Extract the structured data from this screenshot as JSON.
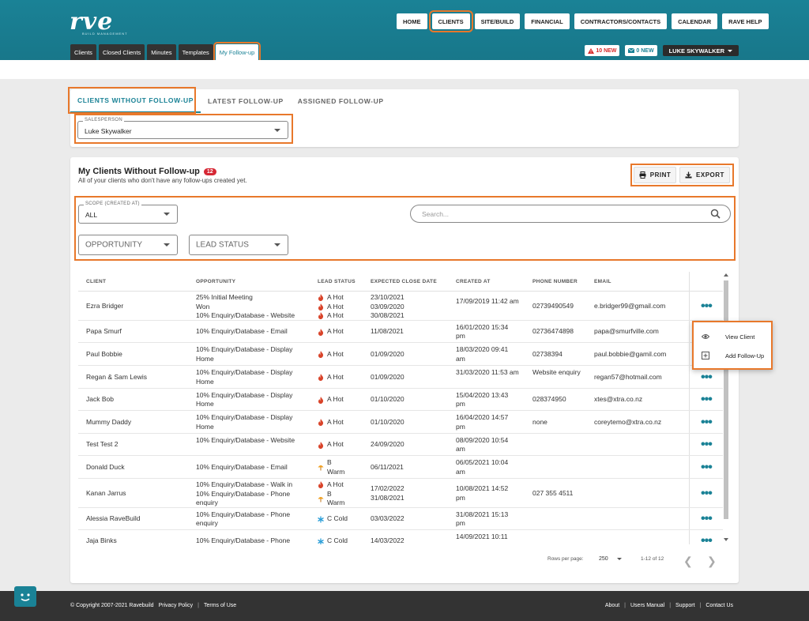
{
  "app": {
    "logo_text": "rve",
    "logo_sub": "BUILD MANAGEMENT"
  },
  "topnav": [
    "HOME",
    "CLIENTS",
    "SITE/BUILD",
    "FINANCIAL",
    "CONTRACTORS/CONTACTS",
    "CALENDAR",
    "RAVE HELP"
  ],
  "subtabs": [
    "Clients",
    "Closed Clients",
    "Minutes",
    "Templates",
    "My Follow-up"
  ],
  "alerts": {
    "red": "10 NEW",
    "blue": "0 NEW",
    "user": "LUKE SKYWALKER"
  },
  "tabs": [
    "CLIENTS WITHOUT FOLLOW-UP",
    "LATEST FOLLOW-UP",
    "ASSIGNED FOLLOW-UP"
  ],
  "salesperson": {
    "legend": "SALESPERSON",
    "value": "Luke Skywalker"
  },
  "section": {
    "title": "My Clients Without Follow-up",
    "badge": "12",
    "subtitle": "All of your clients who don't have any follow-ups created yet.",
    "print": "PRINT",
    "export": "EXPORT"
  },
  "filters": {
    "scope_legend": "SCOPE (CREATED AT)",
    "scope_value": "ALL",
    "search_placeholder": "Search...",
    "opportunity": "OPPORTUNITY",
    "lead_status": "LEAD STATUS"
  },
  "table": {
    "headers": [
      "CLIENT",
      "OPPORTUNITY",
      "LEAD STATUS",
      "EXPECTED CLOSE DATE",
      "CREATED AT",
      "PHONE NUMBER",
      "EMAIL"
    ],
    "rows": [
      {
        "client": "Ezra Bridger",
        "opportunity": [
          "25% Initial Meeting",
          "Won",
          "10% Enquiry/Database - Website"
        ],
        "lead": [
          [
            "fire",
            "A Hot"
          ],
          [
            "fire",
            "A Hot"
          ],
          [
            "fire",
            "A Hot"
          ]
        ],
        "close": [
          "23/10/2021",
          "03/09/2020",
          "30/08/2021"
        ],
        "created": "17/09/2019 11:42 am",
        "phone": "02739490549",
        "email": "e.bridger99@gmail.com"
      },
      {
        "client": "Papa Smurf",
        "opportunity": [
          "10% Enquiry/Database - Email"
        ],
        "lead": [
          [
            "fire",
            "A Hot"
          ]
        ],
        "close": [
          "11/08/2021"
        ],
        "created": "16/01/2020 15:34 pm",
        "phone": "02736474898",
        "email": "papa@smurfville.com"
      },
      {
        "client": "Paul Bobbie",
        "opportunity": [
          "10% Enquiry/Database - Display Home"
        ],
        "lead": [
          [
            "fire",
            "A Hot"
          ]
        ],
        "close": [
          "01/09/2020"
        ],
        "created": "18/03/2020 09:41 am",
        "phone": "02738394",
        "email": "paul.bobbie@gamil.com"
      },
      {
        "client": "Regan & Sam Lewis",
        "opportunity": [
          "10% Enquiry/Database - Display Home"
        ],
        "lead": [
          [
            "fire",
            "A Hot"
          ]
        ],
        "close": [
          "01/09/2020"
        ],
        "created": "31/03/2020 11:53 am",
        "phone": "Website enquiry",
        "email": "regan57@hotmail.com"
      },
      {
        "client": "Jack Bob",
        "opportunity": [
          "10% Enquiry/Database - Display Home"
        ],
        "lead": [
          [
            "fire",
            "A Hot"
          ]
        ],
        "close": [
          "01/10/2020"
        ],
        "created": "15/04/2020 13:43 pm",
        "phone": "028374950",
        "email": "xtes@xtra.co.nz"
      },
      {
        "client": "Mummy Daddy",
        "opportunity": [
          "10% Enquiry/Database - Display Home"
        ],
        "lead": [
          [
            "fire",
            "A Hot"
          ]
        ],
        "close": [
          "01/10/2020"
        ],
        "created": "16/04/2020 14:57 pm",
        "phone": "none",
        "email": "coreytemo@xtra.co.nz"
      },
      {
        "client": "Test Test 2",
        "opportunity": [
          "10% Enquiry/Database - Website"
        ],
        "lead": [
          [
            "fire",
            "A Hot"
          ]
        ],
        "close": [
          "24/09/2020"
        ],
        "created": "08/09/2020 10:54 am",
        "phone": "",
        "email": ""
      },
      {
        "client": "Donald Duck",
        "opportunity": [
          "10% Enquiry/Database - Email"
        ],
        "lead": [
          [
            "warm",
            "B Warm"
          ]
        ],
        "close": [
          "06/11/2021"
        ],
        "created": "06/05/2021 10:04 am",
        "phone": "",
        "email": ""
      },
      {
        "client": "Kanan Jarrus",
        "opportunity": [
          "10% Enquiry/Database - Walk in",
          "10% Enquiry/Database - Phone enquiry"
        ],
        "lead": [
          [
            "fire",
            "A Hot"
          ],
          [
            "warm",
            "B Warm"
          ]
        ],
        "close": [
          "17/02/2022",
          "31/08/2021"
        ],
        "created": "10/08/2021 14:52 pm",
        "phone": "027 355 4511",
        "email": ""
      },
      {
        "client": "Alessia RaveBuild",
        "opportunity": [
          "10% Enquiry/Database - Phone enquiry"
        ],
        "lead": [
          [
            "cold",
            "C Cold"
          ]
        ],
        "close": [
          "03/03/2022"
        ],
        "created": "31/08/2021 15:13 pm",
        "phone": "",
        "email": ""
      },
      {
        "client": "Jaja Binks",
        "opportunity": [
          "10% Enquiry/Database - Phone"
        ],
        "lead": [
          [
            "cold",
            "C Cold"
          ]
        ],
        "close": [
          "14/03/2022"
        ],
        "created": "14/09/2021 10:11",
        "phone": "",
        "email": ""
      }
    ]
  },
  "pagination": {
    "rows_label": "Rows per page:",
    "rows_value": "250",
    "range": "1-12 of 12"
  },
  "context_menu": [
    "View Client",
    "Add Follow-Up"
  ],
  "footer": {
    "copyright": "© Copyright 2007-2021 Ravebuild",
    "privacy": "Privacy Policy",
    "terms": "Terms of Use",
    "links": [
      "About",
      "Users Manual",
      "Support",
      "Contact Us"
    ]
  },
  "colors": {
    "teal": "#1a8296",
    "highlight": "#e8782b",
    "badge_red": "#d62835",
    "fire": "#d9442a",
    "cold": "#2a9ed8",
    "warm": "#f0a020"
  }
}
